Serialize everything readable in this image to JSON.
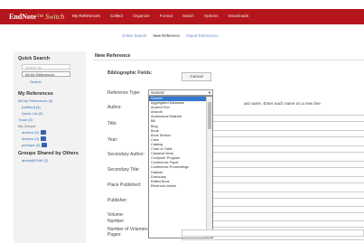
{
  "app": {
    "logo_main": "EndNote",
    "logo_tm": "™",
    "logo_sub": "Switch"
  },
  "nav": [
    "My References",
    "Collect",
    "Organize",
    "Format",
    "Match",
    "Options",
    "Downloads"
  ],
  "subnav": {
    "online_search": "Online Search",
    "new_reference": "New Reference",
    "import": "Import References"
  },
  "sidebar": {
    "quick_search": "Quick Search",
    "search_placeholder": "Search for",
    "search_in": "All My References",
    "search_button": "Search",
    "my_references": "My References",
    "all_refs": "All My References (8)",
    "unfiled": "[Unfiled] (5)",
    "quick_list": "Quick List (0)",
    "trash": "Trash (0)",
    "my_groups": "My Groups",
    "groups": [
      "ancient (3)",
      "doctors (3)",
      "perhaps (3)"
    ],
    "shared_title": "Groups Shared by Others",
    "shared_item": "about@ENW (3)"
  },
  "main": {
    "title": "New Reference",
    "bib_fields": "Bibliographic Fields:",
    "cancel": "Cancel",
    "author_note": "ast name. Enter each name on a new line",
    "labels": [
      "Reference Type:",
      "Author:",
      "Title:",
      "Year:",
      "Secondary Author:",
      "Secondary Title:",
      "Place Published:",
      "Publisher:",
      "Volume:",
      "Number of Volumes:",
      "Number:",
      "Pages:"
    ],
    "reference_type_value": "Generic",
    "reference_types": [
      "Generic",
      "Aggregated Database",
      "Ancient Text",
      "Artwork",
      "Audiovisual Material",
      "Bill",
      "Blog",
      "Book",
      "Book Section",
      "Case",
      "Catalog",
      "Chart or Table",
      "Classical Work",
      "Computer Program",
      "Conference Paper",
      "Conference Proceedings",
      "Dataset",
      "Dictionary",
      "Edited Book",
      "Electronic Article"
    ]
  },
  "colors": {
    "nav_bg": "#b5161b",
    "link": "#3b6db5",
    "selected": "#3478d4"
  }
}
